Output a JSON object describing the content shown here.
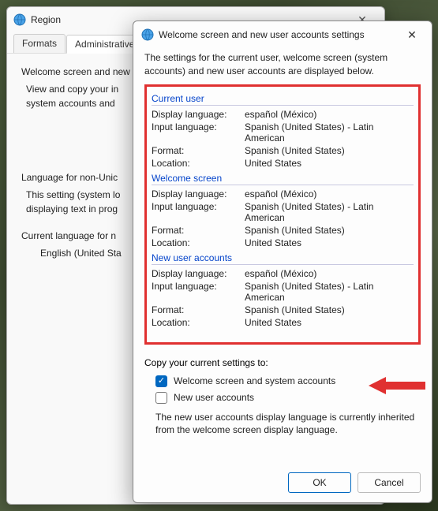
{
  "region": {
    "title": "Region",
    "tabs": {
      "formats": "Formats",
      "admin": "Administrative"
    },
    "group1_title": "Welcome screen and new",
    "group1_text": "View and copy your in\nsystem accounts and",
    "group2_title": "Language for non-Unic",
    "group2_text1": "This setting (system lo",
    "group2_text2": "displaying text in prog",
    "group3_label": "Current language for n",
    "group3_value": "English (United Sta"
  },
  "welcome": {
    "title": "Welcome screen and new user accounts settings",
    "intro": "The settings for the current user, welcome screen (system accounts) and new user accounts are displayed below.",
    "sections": {
      "current_user": {
        "header": "Current user",
        "display_language_k": "Display language:",
        "display_language_v": "español (México)",
        "input_language_k": "Input language:",
        "input_language_v": "Spanish (United States) - Latin American",
        "format_k": "Format:",
        "format_v": "Spanish (United States)",
        "location_k": "Location:",
        "location_v": "United States"
      },
      "welcome_screen": {
        "header": "Welcome screen",
        "display_language_k": "Display language:",
        "display_language_v": "español (México)",
        "input_language_k": "Input language:",
        "input_language_v": "Spanish (United States) - Latin American",
        "format_k": "Format:",
        "format_v": "Spanish (United States)",
        "location_k": "Location:",
        "location_v": "United States"
      },
      "new_user": {
        "header": "New user accounts",
        "display_language_k": "Display language:",
        "display_language_v": "español (México)",
        "input_language_k": "Input language:",
        "input_language_v": "Spanish (United States) - Latin American",
        "format_k": "Format:",
        "format_v": "Spanish (United States)",
        "location_k": "Location:",
        "location_v": "United States"
      }
    },
    "copy": {
      "label": "Copy your current settings to:",
      "welcome_chk": "Welcome screen and system accounts",
      "newuser_chk": "New user accounts",
      "note": "The new user accounts display language is currently inherited from the welcome screen display language."
    },
    "buttons": {
      "ok": "OK",
      "cancel": "Cancel"
    }
  }
}
